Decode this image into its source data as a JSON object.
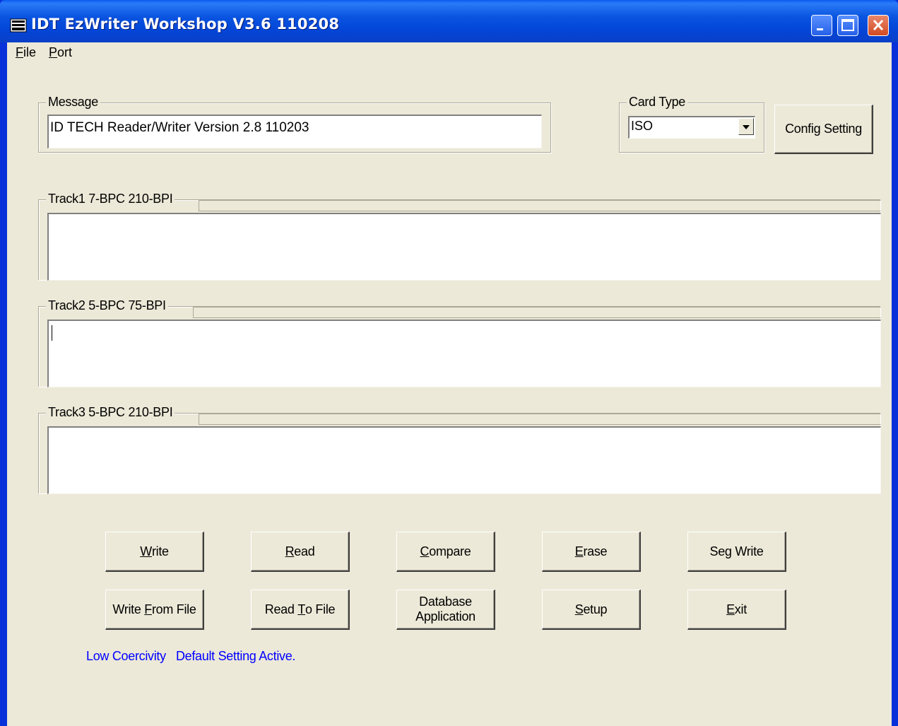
{
  "window": {
    "title": "IDT EzWriter Workshop V3.6 110208",
    "minimize_icon": "minimize-icon",
    "maximize_icon": "maximize-icon",
    "close_icon": "close-icon"
  },
  "menu": {
    "file": {
      "underline": "F",
      "rest": "ile"
    },
    "port": {
      "underline": "P",
      "rest": "ort"
    }
  },
  "message": {
    "label": "Message",
    "value": "ID TECH Reader/Writer Version 2.8 110203"
  },
  "card_type": {
    "label": "Card Type",
    "selected": "ISO"
  },
  "config_button": "Config Setting",
  "tracks": [
    {
      "label": "Track1   7-BPC   210-BPI",
      "value": ""
    },
    {
      "label": "Track2   5-BPC   75-BPI",
      "value": ""
    },
    {
      "label": "Track3   5-BPC   210-BPI",
      "value": ""
    }
  ],
  "buttons": {
    "write": {
      "underline": "W",
      "rest": "rite"
    },
    "read": {
      "underline": "R",
      "rest": "ead"
    },
    "compare": {
      "underline": "C",
      "rest": "ompare"
    },
    "erase": {
      "underline": "E",
      "rest": "rase"
    },
    "seg_write": "Seg Write",
    "write_from_file": {
      "pre": "Write ",
      "underline": "F",
      "rest": "rom File"
    },
    "read_to_file": {
      "pre": "Read ",
      "underline": "T",
      "rest": "o File"
    },
    "database_application": {
      "line1": "Database",
      "line2": "Application"
    },
    "setup": {
      "underline": "S",
      "rest": "etup"
    },
    "exit": {
      "underline": "E",
      "rest": "xit"
    }
  },
  "status": "Low Coercivity   Default Setting Active.",
  "colors": {
    "titlebar": "#0a54e0",
    "status_text": "#0000ff",
    "close_button": "#d24a22"
  }
}
